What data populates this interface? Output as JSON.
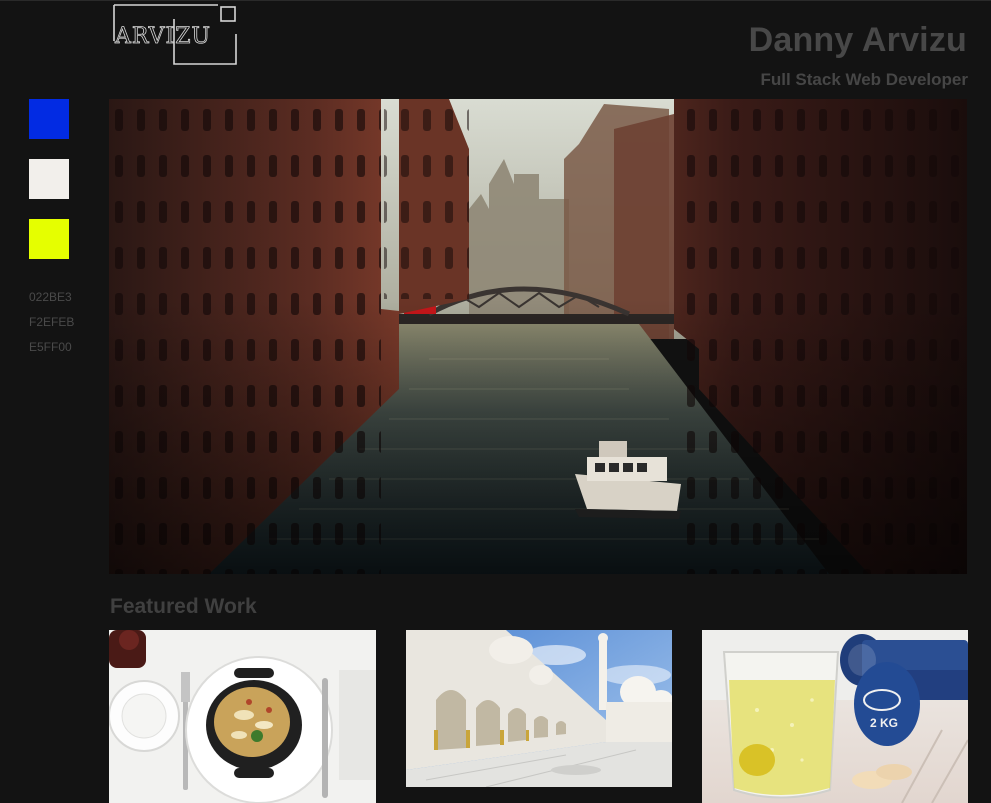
{
  "header": {
    "logo_text": "ARVIZU",
    "name": "Danny Arvizu",
    "role": "Full Stack Web Developer"
  },
  "palette": {
    "swatches": [
      {
        "hex": "022BE3",
        "color": "#022BE3"
      },
      {
        "hex": "F2EFEB",
        "color": "#F2EFEB"
      },
      {
        "hex": "E5FF00",
        "color": "#E5FF00"
      }
    ]
  },
  "hero": {
    "image": "canal-warehouse-photo"
  },
  "featured": {
    "title": "Featured Work",
    "items": [
      {
        "image": "food-plate-photo"
      },
      {
        "image": "mosque-arches-photo"
      },
      {
        "image": "glass-and-dumbbells-photo"
      }
    ],
    "dumbbell_label": "2 KG"
  }
}
